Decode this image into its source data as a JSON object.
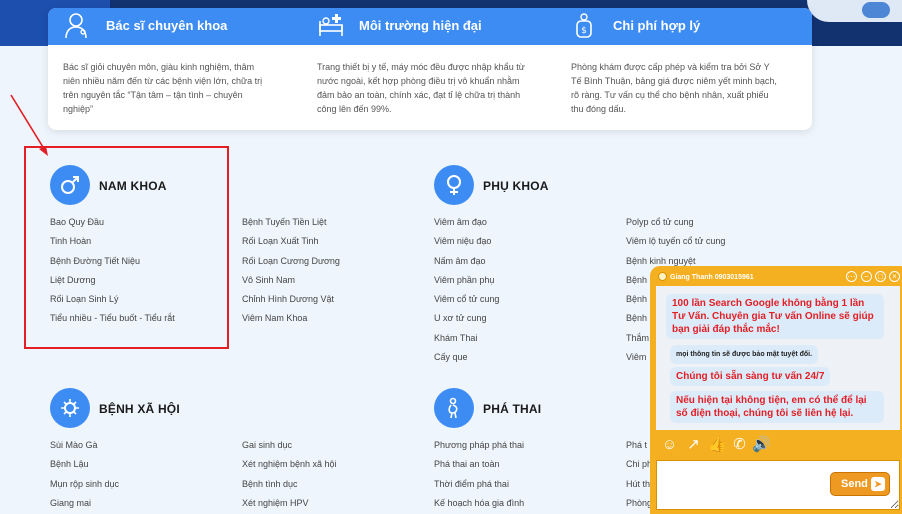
{
  "features": [
    {
      "title": "Bác sĩ chuyên khoa",
      "text": [
        "Bác sĩ giỏi chuyên môn, giàu kinh nghiệm, thâm",
        "niên nhiều năm đến từ các bệnh viện lớn, chữa trị",
        "trên nguyên tắc “Tận tâm – tận tình – chuyên",
        "nghiệp”"
      ],
      "icon": "doctor-icon"
    },
    {
      "title": "Môi trường hiện đại",
      "text": [
        "Trang thiết bị y tế, máy móc đều được nhập khẩu từ",
        "nước ngoài, kết hợp phòng điều trị vô khuẩn nhằm",
        "đảm bảo an toàn, chính xác, đạt tỉ lệ chữa trị thành",
        "công lên đến 99%."
      ],
      "icon": "hospital-bed-icon"
    },
    {
      "title": "Chi phí hợp lý",
      "text": [
        "Phòng khám được cấp phép và kiểm tra bởi Sở Y",
        "Tế Bình Thuận, bảng giá được niêm yết minh bạch,",
        "rõ ràng. Tư vấn cụ thể cho bệnh nhân, xuất phiếu",
        "thu đóng dấu."
      ],
      "icon": "piggy-bank-icon"
    }
  ],
  "categories": {
    "nam_khoa": {
      "title": "NAM KHOA",
      "col1": [
        "Bao Quy Đầu",
        "Tinh Hoàn",
        "Bệnh Đường Tiết Niệu",
        "Liệt Dương",
        "Rối Loạn Sinh Lý",
        "Tiểu nhiều - Tiểu buốt - Tiểu rắt"
      ],
      "col2": [
        "Bệnh Tuyến Tiền Liệt",
        "Rối Loạn Xuất Tinh",
        "Rối Loạn Cương Dương",
        "Vô Sinh Nam",
        "Chỉnh Hình Dương Vật",
        "Viêm Nam Khoa"
      ]
    },
    "phu_khoa": {
      "title": "PHỤ KHOA",
      "col1": [
        "Viêm âm đạo",
        "Viêm niệu đạo",
        "Nấm âm đạo",
        "Viêm phần phụ",
        "Viêm cổ tử cung",
        "U xơ tử cung",
        "Khám Thai",
        "Cấy que"
      ],
      "col2": [
        "Polyp cổ tử cung",
        "Viêm lộ tuyến cổ tử cung",
        "Bệnh kinh nguyệt",
        "Bệnh",
        "Bệnh",
        "Bệnh",
        "Thắm",
        "Viêm"
      ]
    },
    "benh_xa_hoi": {
      "title": "BỆNH XÃ HỘI",
      "col1": [
        "Sùi Mào Gà",
        "Bệnh Lậu",
        "Mụn rộp sinh dục",
        "Giang mai"
      ],
      "col2": [
        "Gai sinh dục",
        "Xét nghiệm bệnh xã hội",
        "Bệnh tình dục",
        "Xét nghiệm HPV"
      ]
    },
    "pha_thai": {
      "title": "PHÁ THAI",
      "col1": [
        "Phương pháp phá thai",
        "Phá thai an toàn",
        "Thời điểm phá thai",
        "Kế hoạch hóa gia đình"
      ],
      "col2": [
        "Phá t",
        "Chi ph",
        "Hút th",
        "Phòng"
      ]
    }
  },
  "chat": {
    "agent_name": "Giang Thanh 0903015961",
    "messages": [
      "100 lần Search Google không bằng 1 lần Tư Vấn. Chuyên gia Tư vấn Online sẽ giúp bạn giải đáp thắc mắc!",
      "mọi thông tin sẽ được bảo mật tuyệt đối.",
      "Chúng tôi sẵn sàng tư vấn 24/7",
      "Nếu hiện tại không tiện, em có thể để lại số điện thoại, chúng tôi sẽ liên hệ lại."
    ],
    "send_label": "Send",
    "input_value": ""
  },
  "colors": {
    "accent": "#3d8cf4",
    "banner": "#12316f",
    "chat": "#f4b020",
    "highlight": "#e31e24"
  }
}
